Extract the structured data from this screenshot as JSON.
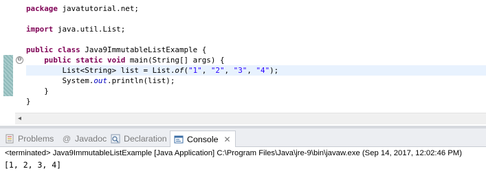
{
  "editor": {
    "lines": [
      [
        {
          "t": "package",
          "c": "kw"
        },
        {
          "t": " javatutorial.net;"
        }
      ],
      [],
      [
        {
          "t": "import",
          "c": "kw"
        },
        {
          "t": " java.util.List;"
        }
      ],
      [],
      [
        {
          "t": "public",
          "c": "kw"
        },
        {
          "t": " "
        },
        {
          "t": "class",
          "c": "kw"
        },
        {
          "t": " Java9ImmutableListExample {"
        }
      ],
      [
        {
          "t": "    "
        },
        {
          "t": "public",
          "c": "kw"
        },
        {
          "t": " "
        },
        {
          "t": "static",
          "c": "kw"
        },
        {
          "t": " "
        },
        {
          "t": "void",
          "c": "kw"
        },
        {
          "t": " main(String[] args) {"
        }
      ],
      [
        {
          "t": "        List<String> list = List."
        },
        {
          "t": "of",
          "c": "ital"
        },
        {
          "t": "("
        },
        {
          "t": "\"1\"",
          "c": "str"
        },
        {
          "t": ", "
        },
        {
          "t": "\"2\"",
          "c": "str"
        },
        {
          "t": ", "
        },
        {
          "t": "\"3\"",
          "c": "str"
        },
        {
          "t": ", "
        },
        {
          "t": "\"4\"",
          "c": "str"
        },
        {
          "t": ");"
        }
      ],
      [
        {
          "t": "        System."
        },
        {
          "t": "out",
          "c": "fld"
        },
        {
          "t": ".println(list);"
        }
      ],
      [
        {
          "t": "    }"
        }
      ],
      [
        {
          "t": "}"
        }
      ]
    ],
    "current_line_index": 6,
    "fold_marker": "⊖"
  },
  "panel": {
    "tabs": [
      {
        "label": "Problems",
        "icon": "problems-icon"
      },
      {
        "label": "Javadoc",
        "icon": "at-sign-icon"
      },
      {
        "label": "Declaration",
        "icon": "declaration-icon"
      },
      {
        "label": "Console",
        "icon": "console-icon",
        "active": true,
        "close": "✕"
      }
    ],
    "console_header": "<terminated> Java9ImmutableListExample [Java Application] C:\\Program Files\\Java\\jre-9\\bin\\javaw.exe (Sep 14, 2017, 12:02:46 PM)",
    "console_output": "[1, 2, 3, 4]"
  },
  "colors": {
    "keyword": "#7f0055",
    "string": "#2a00ff",
    "field": "#0000c0",
    "current_line": "#e8f2fe",
    "change_ruler": "#8fb9b9"
  }
}
